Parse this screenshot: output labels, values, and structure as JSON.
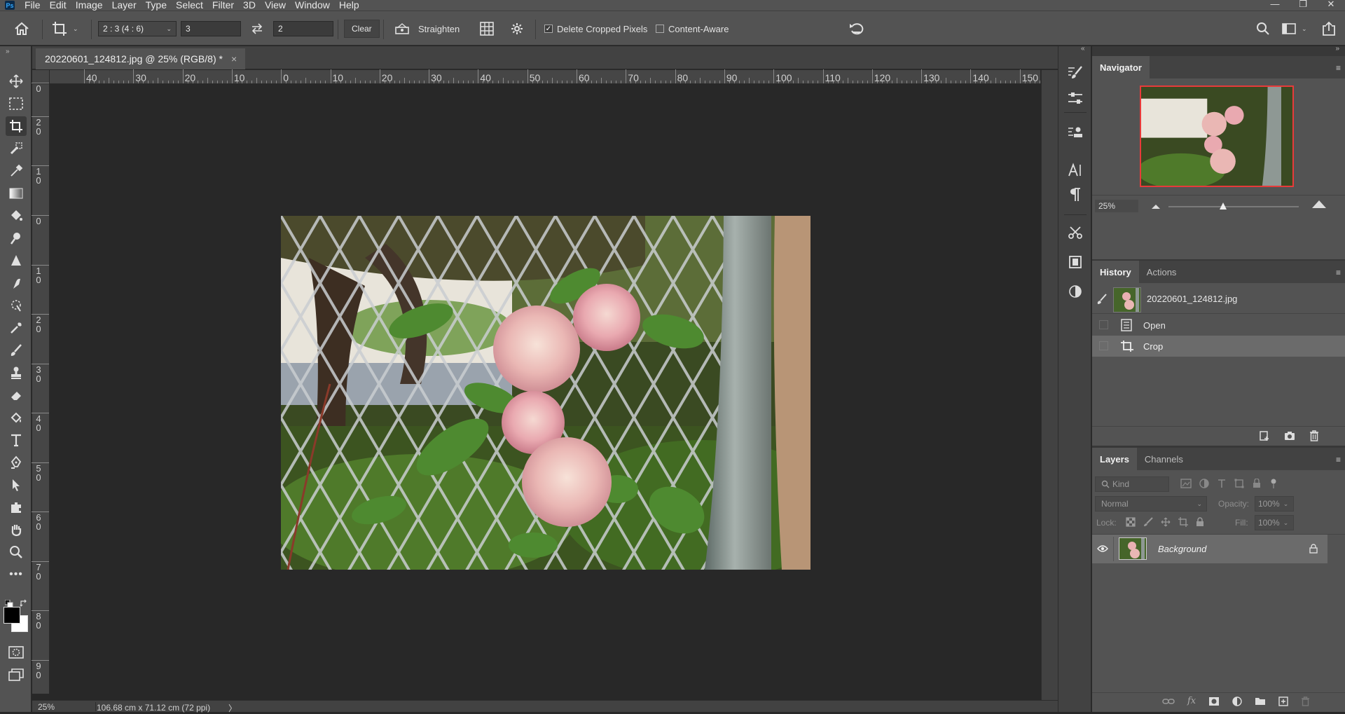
{
  "menubar": {
    "logo": "Ps",
    "items": [
      "File",
      "Edit",
      "Image",
      "Layer",
      "Type",
      "Select",
      "Filter",
      "3D",
      "View",
      "Window",
      "Help"
    ],
    "window_controls": [
      "—",
      "❐",
      "✕"
    ]
  },
  "options_bar": {
    "ratio_preset": "2 : 3 (4 : 6)",
    "width_value": "3",
    "height_value": "2",
    "clear_label": "Clear",
    "straighten_label": "Straighten",
    "delete_cropped_label": "Delete Cropped Pixels",
    "delete_cropped_checked": true,
    "content_aware_label": "Content-Aware",
    "content_aware_checked": false
  },
  "document": {
    "tab_title": "20220601_124812.jpg @ 25% (RGB/8) *",
    "zoom": "25%",
    "dimensions": "106.68 cm x 71.12 cm (72 ppi)",
    "status_arrow": "〉"
  },
  "rulers": {
    "horizontal_labels": [
      "40",
      "30",
      "20",
      "10",
      "0",
      "10",
      "20",
      "30",
      "40",
      "50",
      "60",
      "70",
      "80",
      "90",
      "100",
      "110",
      "120",
      "130",
      "140",
      "150"
    ],
    "vertical_labels": [
      "0",
      "2\n0",
      "1\n0",
      "0",
      "1\n0",
      "2\n0",
      "3\n0",
      "4\n0",
      "5\n0",
      "6\n0",
      "7\n0",
      "8\n0",
      "9\n0"
    ]
  },
  "navigator": {
    "tab_label": "Navigator",
    "zoom_value": "25%",
    "zoom_fraction": 0.42
  },
  "history": {
    "tabs": [
      "History",
      "Actions"
    ],
    "snapshot_name": "20220601_124812.jpg",
    "states": [
      {
        "label": "Open",
        "icon": "document-icon"
      },
      {
        "label": "Crop",
        "icon": "crop-icon",
        "selected": true
      }
    ]
  },
  "layers": {
    "tabs": [
      "Layers",
      "Channels"
    ],
    "filter_kind": "Kind",
    "blend_mode": "Normal",
    "opacity_label": "Opacity:",
    "opacity_value": "100%",
    "lock_label": "Lock:",
    "fill_label": "Fill:",
    "fill_value": "100%",
    "layer_name": "Background"
  },
  "colors": {
    "accent_selection": "#e83a3a",
    "panel_bg": "#535353",
    "canvas_bg": "#282828",
    "foreground_color": "#000000",
    "background_color": "#ffffff"
  }
}
